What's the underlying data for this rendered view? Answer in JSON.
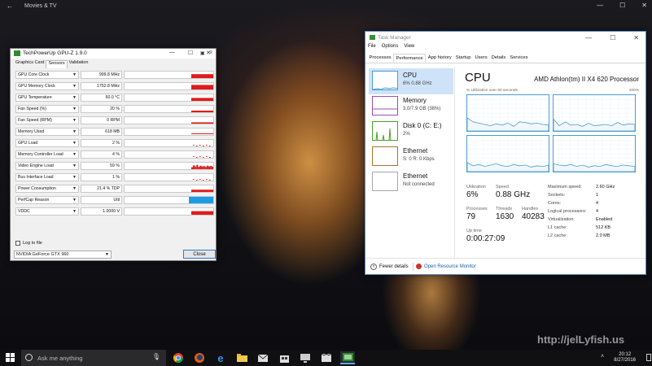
{
  "app": {
    "title": "Movies & TV",
    "watermark": "http://jelLyfish.us"
  },
  "gpuz": {
    "title": "TechPowerUp GPU-Z 1.9.0",
    "tabs": [
      "Graphics Card",
      "Sensors",
      "Validation"
    ],
    "active_tab": "Sensors",
    "sensors": [
      {
        "label": "GPU Core Clock",
        "value": "999.8 MHz",
        "graph": "bar",
        "level": 0.6
      },
      {
        "label": "GPU Memory Clock",
        "value": "1752.8 MHz",
        "graph": "bar",
        "level": 0.7
      },
      {
        "label": "GPU Temperature",
        "value": "60.0 °C",
        "graph": "bar",
        "level": 0.45
      },
      {
        "label": "Fan Speed (%)",
        "value": "20 %",
        "graph": "bar",
        "level": 0.25
      },
      {
        "label": "Fan Speed (RPM)",
        "value": "0 RPM",
        "graph": "bar",
        "level": 0.2
      },
      {
        "label": "Memory Used",
        "value": "618 MB",
        "graph": "line",
        "level": 0.1
      },
      {
        "label": "GPU Load",
        "value": "2 %",
        "graph": "dots",
        "level": 0.05
      },
      {
        "label": "Memory Controller Load",
        "value": "4 %",
        "graph": "dots",
        "level": 0.05
      },
      {
        "label": "Video Engine Load",
        "value": "59 %",
        "graph": "spiky",
        "level": 0.6
      },
      {
        "label": "Bus Interface Load",
        "value": "1 %",
        "graph": "dots",
        "level": 0.03
      },
      {
        "label": "Power Consumption",
        "value": "21.4 % TDP",
        "graph": "bar",
        "level": 0.35
      },
      {
        "label": "PerfCap Reason",
        "value": "Util",
        "graph": "blue",
        "level": 1
      },
      {
        "label": "VDDC",
        "value": "1.0000 V",
        "graph": "bar",
        "level": 0.55
      }
    ],
    "log_label": "Log to file",
    "gpu_selected": "NVIDIA GeForce GTX 960",
    "close_label": "Close"
  },
  "taskmgr": {
    "title": "Task Manager",
    "menu": [
      "File",
      "Options",
      "View"
    ],
    "tabs": [
      "Processes",
      "Performance",
      "App history",
      "Startup",
      "Users",
      "Details",
      "Services"
    ],
    "active_tab": "Performance",
    "items": [
      {
        "name": "CPU",
        "sub": "6% 0.88 GHz",
        "color": "#4a9dd1",
        "active": true
      },
      {
        "name": "Memory",
        "sub": "3.0/7.9 GB (38%)",
        "color": "#9b4fb0",
        "active": false
      },
      {
        "name": "Disk 0 (C: E:)",
        "sub": "2%",
        "color": "#4aa02c",
        "active": false
      },
      {
        "name": "Ethernet",
        "sub": "S: 0 R: 0 Kbps",
        "color": "#a8762a",
        "active": false
      },
      {
        "name": "Ethernet",
        "sub": "Not connected",
        "color": "#a8a8a8",
        "active": false
      }
    ],
    "cpu": {
      "heading": "CPU",
      "processor": "AMD Athlon(tm) II X4 620 Processor",
      "util_label": "% Utilization over 60 seconds",
      "util_max": "100%",
      "stats": [
        {
          "key": "Utilization",
          "value": "6%"
        },
        {
          "key": "Speed",
          "value": "0.88 GHz"
        },
        {
          "key": "Processes",
          "value": "79"
        },
        {
          "key": "Threads",
          "value": "1630"
        },
        {
          "key": "Handles",
          "value": "40283"
        },
        {
          "key": "Up time",
          "value": "0:00:27:09"
        }
      ],
      "details": [
        {
          "key": "Maximum speed:",
          "value": "2.60 GHz"
        },
        {
          "key": "Sockets:",
          "value": "1"
        },
        {
          "key": "Cores:",
          "value": "4"
        },
        {
          "key": "Logical processors:",
          "value": "4"
        },
        {
          "key": "Virtualization:",
          "value": "Enabled"
        },
        {
          "key": "L1 cache:",
          "value": "512 KB"
        },
        {
          "key": "L2 cache:",
          "value": "2.0 MB"
        }
      ]
    },
    "fewer_details": "Fewer details",
    "resource_monitor": "Open Resource Monitor"
  },
  "taskbar": {
    "search_placeholder": "Ask me anything",
    "time": "20:12",
    "date": "8/27/2016"
  }
}
